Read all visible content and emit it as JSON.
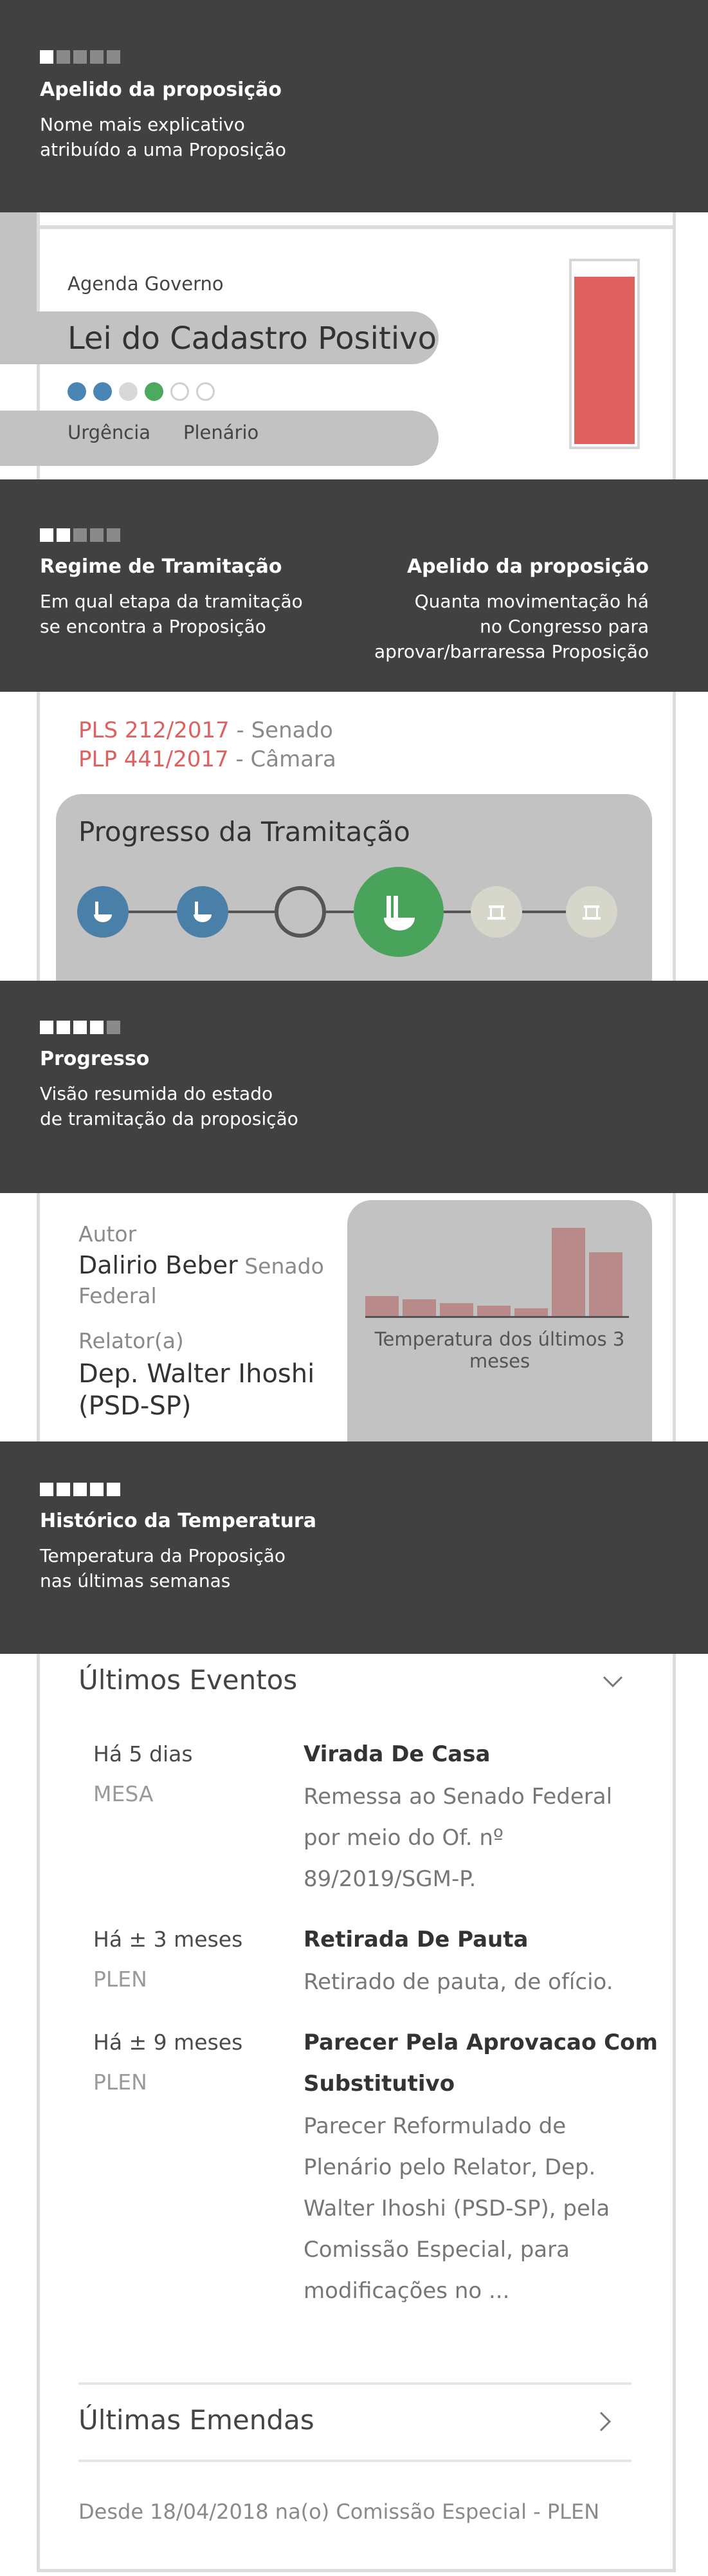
{
  "tour_top": {
    "step_active": 1,
    "step_total": 5,
    "title": "Apelido da proposição",
    "text_line1": "Nome mais explicativo",
    "text_line2": "atribuído a uma Proposição"
  },
  "header": {
    "agenda": "Agenda Governo",
    "nickname": "Lei do Cadastro Positivo",
    "urgency_dots": [
      "#4a86b4",
      "#4a86b4",
      "#d8d8d8",
      "#4aaa5e",
      "#ffffff",
      "#ffffff"
    ],
    "regime": "Urgência",
    "stage": "Plenário",
    "temperature_bar_color": "#e06060",
    "temperature_level": 0.93
  },
  "tour_regime": {
    "step_active": 2,
    "step_total": 5,
    "left_title": "Regime de Tramitação",
    "left_line1": "Em qual etapa da tramitação",
    "left_line2": "se encontra a Proposição",
    "right_title": "Apelido da proposição",
    "right_line1": "Quanta movimentação há",
    "right_line2": "no Congresso para",
    "right_line3": "aprovar/barraressa Proposição"
  },
  "ids": [
    {
      "code": "PLS 212/2017",
      "house": " - Senado"
    },
    {
      "code": "PLP 441/2017",
      "house": " - Câmara"
    }
  ],
  "progress": {
    "title": "Progresso da Tramitação",
    "nodes": [
      {
        "state": "done",
        "icon": "senate-icon"
      },
      {
        "state": "done",
        "icon": "senate-icon"
      },
      {
        "state": "empty",
        "icon": "empty-stage-icon"
      },
      {
        "state": "current",
        "icon": "chamber-icon"
      },
      {
        "state": "future",
        "icon": "sanction-icon"
      },
      {
        "state": "future",
        "icon": "sanction-icon"
      }
    ]
  },
  "tour_progress": {
    "step_active": 4,
    "step_total": 5,
    "title": "Progresso",
    "text_line1": "Visão resumida do estado",
    "text_line2": "de tramitação da proposição"
  },
  "author": {
    "label": "Autor",
    "name": "Dalirio Beber",
    "house": " Senado Federal",
    "rapporteur_label": "Relator(a)",
    "rapporteur": "Dep. Walter Ihoshi (PSD-SP)"
  },
  "temperature": {
    "caption_line1": "Temperatura dos últimos 3",
    "caption_line2": "meses",
    "bar_color": "#b88a8a",
    "values": [
      0.19,
      0.16,
      0.12,
      0.1,
      0.07,
      0.83,
      0.6
    ]
  },
  "tour_temperature": {
    "step_active": 5,
    "step_total": 5,
    "title": "Histórico da Temperatura",
    "text_line1": "Temperatura da Proposição",
    "text_line2": "nas últimas semanas"
  },
  "events": {
    "title": "Últimos Eventos",
    "items": [
      {
        "date": "Há 5 dias",
        "org": "MESA",
        "title_lines": [
          "Virada De Casa"
        ],
        "desc_lines": [
          "Remessa ao Senado Federal",
          "por meio do Of. nº",
          "89/2019/SGM-P."
        ]
      },
      {
        "date": "Há ± 3 meses",
        "org": "PLEN",
        "title_lines": [
          "Retirada De Pauta"
        ],
        "desc_lines": [
          "Retirado de pauta, de ofício."
        ]
      },
      {
        "date": "Há ± 9 meses",
        "org": "PLEN",
        "title_lines": [
          "Parecer Pela Aprovacao Com",
          "Substitutivo"
        ],
        "desc_lines": [
          "Parecer Reformulado de",
          "Plenário pelo Relator, Dep.",
          "Walter Ihoshi (PSD-SP), pela",
          "Comissão Especial, para",
          "modificações no ..."
        ]
      }
    ]
  },
  "amendments": {
    "title": "Últimas Emendas",
    "footer": "Desde 18/04/2018 na(o) Comissão Especial - PLEN"
  }
}
